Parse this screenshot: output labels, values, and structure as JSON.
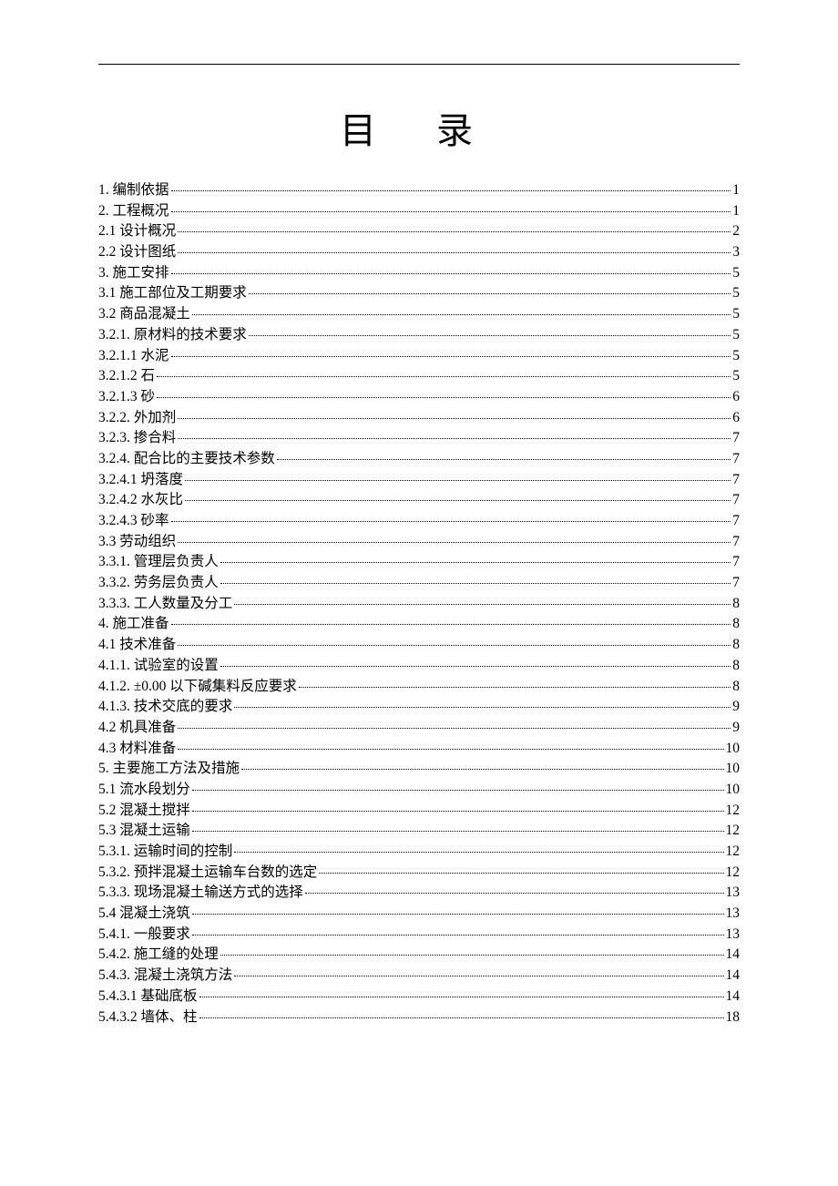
{
  "title": "目 录",
  "toc": [
    {
      "label": "1.  编制依据",
      "page": "1"
    },
    {
      "label": "2.  工程概况",
      "page": "1"
    },
    {
      "label": "2.1  设计概况",
      "page": "2"
    },
    {
      "label": "2.2  设计图纸",
      "page": "3"
    },
    {
      "label": "3.  施工安排",
      "page": "5"
    },
    {
      "label": "3.1  施工部位及工期要求",
      "page": "5"
    },
    {
      "label": "3.2  商品混凝土",
      "page": "5"
    },
    {
      "label": "3.2.1.  原材料的技术要求",
      "page": "5"
    },
    {
      "label": "3.2.1.1  水泥",
      "page": "5"
    },
    {
      "label": "3.2.1.2  石",
      "page": "5"
    },
    {
      "label": "3.2.1.3  砂",
      "page": "6"
    },
    {
      "label": "3.2.2.  外加剂",
      "page": "6"
    },
    {
      "label": "3.2.3.  掺合料",
      "page": "7"
    },
    {
      "label": "3.2.4.  配合比的主要技术参数",
      "page": "7"
    },
    {
      "label": "3.2.4.1  坍落度",
      "page": "7"
    },
    {
      "label": "3.2.4.2  水灰比",
      "page": "7"
    },
    {
      "label": "3.2.4.3  砂率",
      "page": "7"
    },
    {
      "label": "3.3  劳动组织",
      "page": "7"
    },
    {
      "label": "3.3.1.  管理层负责人",
      "page": "7"
    },
    {
      "label": "3.3.2.  劳务层负责人",
      "page": "7"
    },
    {
      "label": "3.3.3.  工人数量及分工",
      "page": "8"
    },
    {
      "label": "4.  施工准备",
      "page": "8"
    },
    {
      "label": "4.1  技术准备",
      "page": "8"
    },
    {
      "label": "4.1.1.  试验室的设置",
      "page": "8"
    },
    {
      "label": "4.1.2. ±0.00 以下碱集料反应要求",
      "page": "8"
    },
    {
      "label": "4.1.3.  技术交底的要求",
      "page": "9"
    },
    {
      "label": "4.2  机具准备",
      "page": "9"
    },
    {
      "label": "4.3  材料准备",
      "page": "10"
    },
    {
      "label": "5.  主要施工方法及措施",
      "page": "10"
    },
    {
      "label": "5.1  流水段划分",
      "page": "10"
    },
    {
      "label": "5.2  混凝土搅拌",
      "page": "12"
    },
    {
      "label": "5.3  混凝土运输",
      "page": "12"
    },
    {
      "label": "5.3.1.  运输时间的控制",
      "page": "12"
    },
    {
      "label": "5.3.2.  预拌混凝土运输车台数的选定",
      "page": "12"
    },
    {
      "label": "5.3.3.  现场混凝土输送方式的选择",
      "page": "13"
    },
    {
      "label": "5.4  混凝土浇筑",
      "page": "13"
    },
    {
      "label": "5.4.1.  一般要求",
      "page": "13"
    },
    {
      "label": "5.4.2.  施工缝的处理",
      "page": "14"
    },
    {
      "label": "5.4.3.  混凝土浇筑方法",
      "page": "14"
    },
    {
      "label": "5.4.3.1  基础底板",
      "page": "14"
    },
    {
      "label": "5.4.3.2  墙体、柱",
      "page": "18"
    }
  ]
}
